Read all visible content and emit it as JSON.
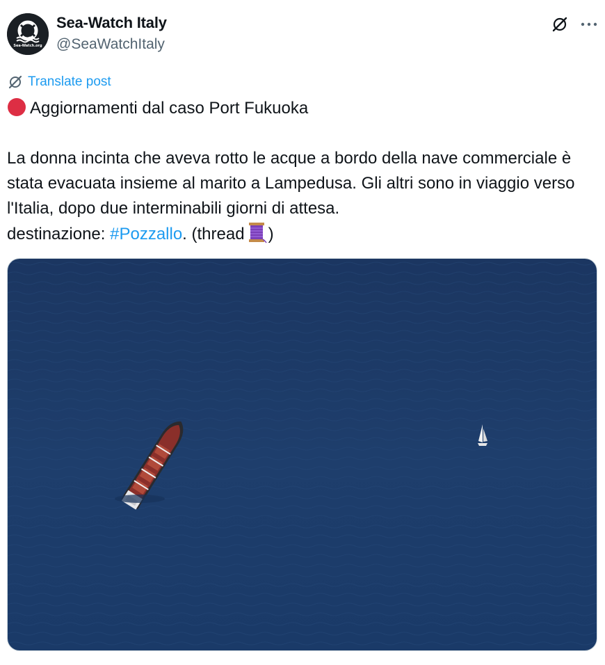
{
  "author": {
    "display_name": "Sea-Watch Italy",
    "handle": "@SeaWatchItaly",
    "avatar_text": "Sea-Watch.org"
  },
  "actions": {
    "grok_icon": "grok-icon",
    "more_icon": "more-icon"
  },
  "translate": {
    "label": "Translate post"
  },
  "post": {
    "headline": "Aggiornamenti dal caso Port Fukuoka",
    "body_line": "La donna incinta che aveva rotto le acque a bordo della nave commerciale è stata evacuata insieme al marito a Lampedusa. Gli altri sono in viaggio verso l'Italia, dopo due interminabili giorni di attesa.",
    "destination_prefix": "destinazione: ",
    "hashtag": "#Pozzallo",
    "thread_prefix": ". (thread",
    "thread_suffix": ")"
  },
  "colors": {
    "accent": "#1d9bf0",
    "text": "#0f1419",
    "secondary": "#536471",
    "sea": "#1c3a66"
  }
}
